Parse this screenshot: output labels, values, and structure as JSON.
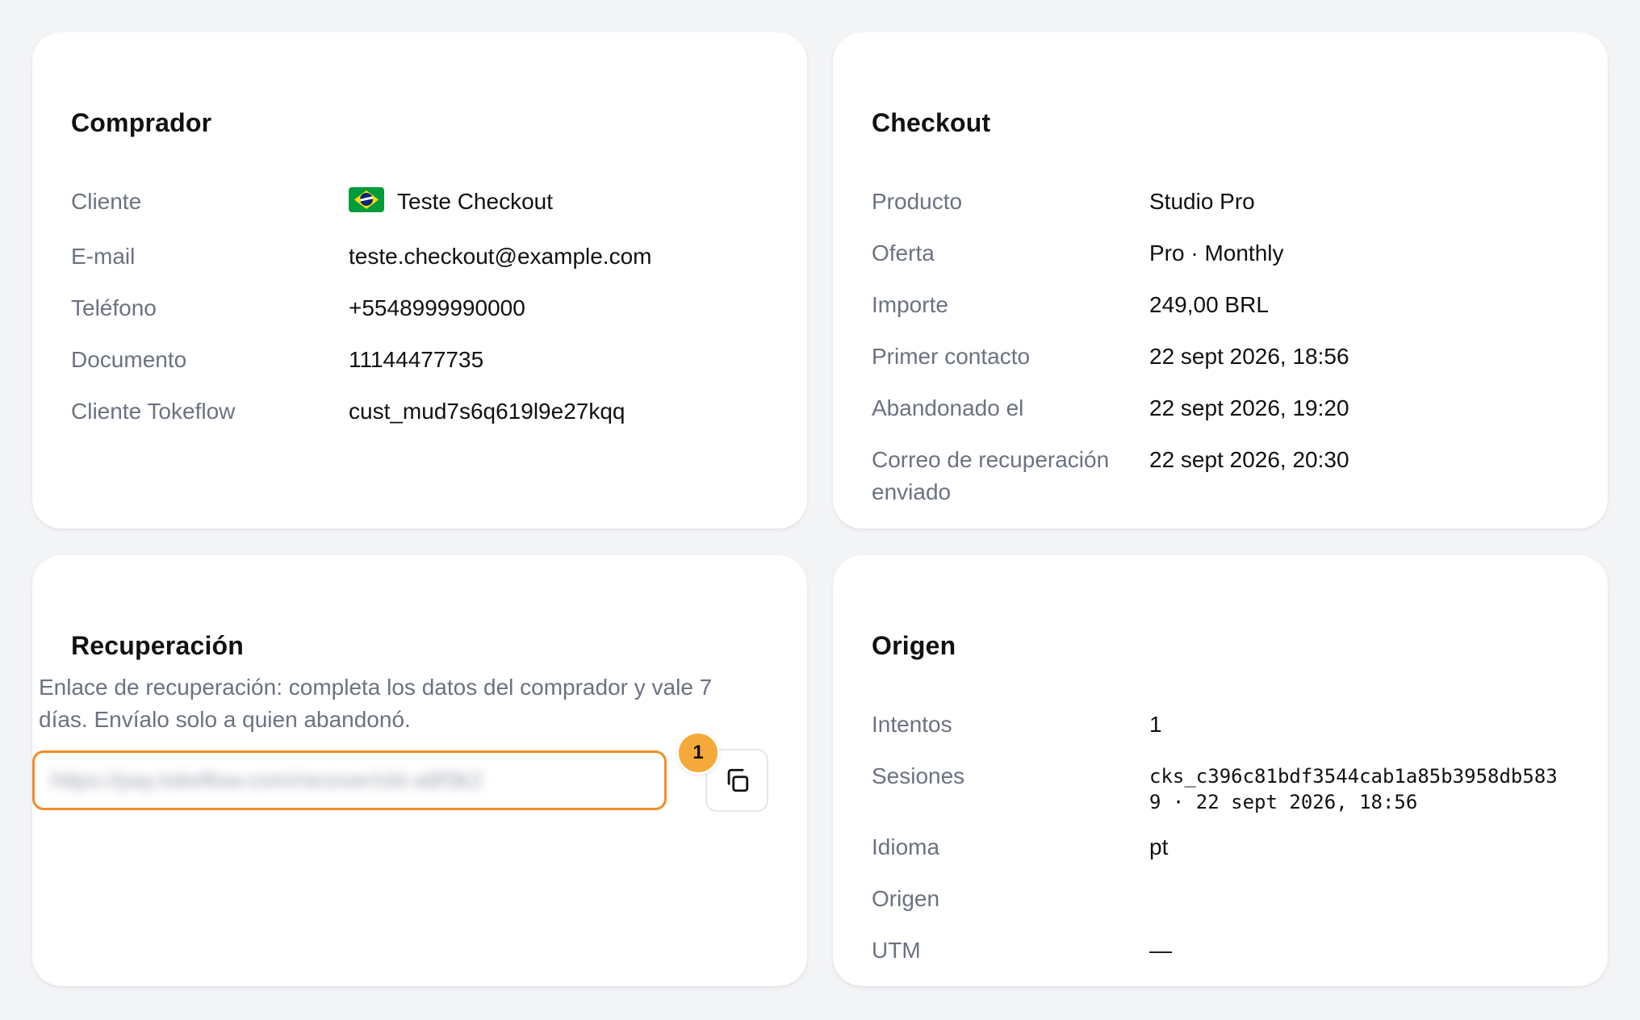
{
  "comprador": {
    "title": "Comprador",
    "rows": [
      {
        "label": "Cliente",
        "value": "Teste Checkout",
        "icon": "brazil-flag-icon"
      },
      {
        "label": "E-mail",
        "value": "teste.checkout@example.com"
      },
      {
        "label": "Teléfono",
        "value": "+5548999990000"
      },
      {
        "label": "Documento",
        "value": "11144477735"
      },
      {
        "label": "Cliente Tokeflow",
        "value": "cust_mud7s6q619l9e27kqq"
      }
    ]
  },
  "checkout": {
    "title": "Checkout",
    "rows": [
      {
        "label": "Producto",
        "value": "Studio Pro"
      },
      {
        "label": "Oferta",
        "value": "Pro · Monthly"
      },
      {
        "label": "Importe",
        "value": "249,00 BRL"
      },
      {
        "label": "Primer contacto",
        "value": "22 sept 2026, 18:56"
      },
      {
        "label": "Abandonado el",
        "value": "22 sept 2026, 19:20"
      },
      {
        "label": "Correo de recuperación enviado",
        "value": "22 sept 2026, 20:30"
      }
    ]
  },
  "recuperacion": {
    "title": "Recuperación",
    "description": "Enlace de recuperación: completa los datos del comprador y vale 7 días. Envíalo solo a quien abandonó.",
    "link_value": "https://pay.tokeflow.com/recover/ckt-a8f3k2",
    "badge": "1",
    "copy_icon": "copy-icon"
  },
  "origen": {
    "title": "Origen",
    "rows": [
      {
        "label": "Intentos",
        "value": "1"
      },
      {
        "label": "Sesiones",
        "value": "cks_c396c81bdf3544cab1a85b3958db5839 · 22 sept 2026, 18:56",
        "mono": true
      },
      {
        "label": "Idioma",
        "value": "pt"
      },
      {
        "label": "Origen",
        "value": ""
      },
      {
        "label": "UTM",
        "value": "—"
      }
    ]
  },
  "colors": {
    "page_background": "#f3f4f6",
    "card_background": "#ffffff",
    "label_text": "#6b7280",
    "value_text": "#111111",
    "highlight_border": "#f28c28",
    "badge_background": "#f6a93b"
  }
}
